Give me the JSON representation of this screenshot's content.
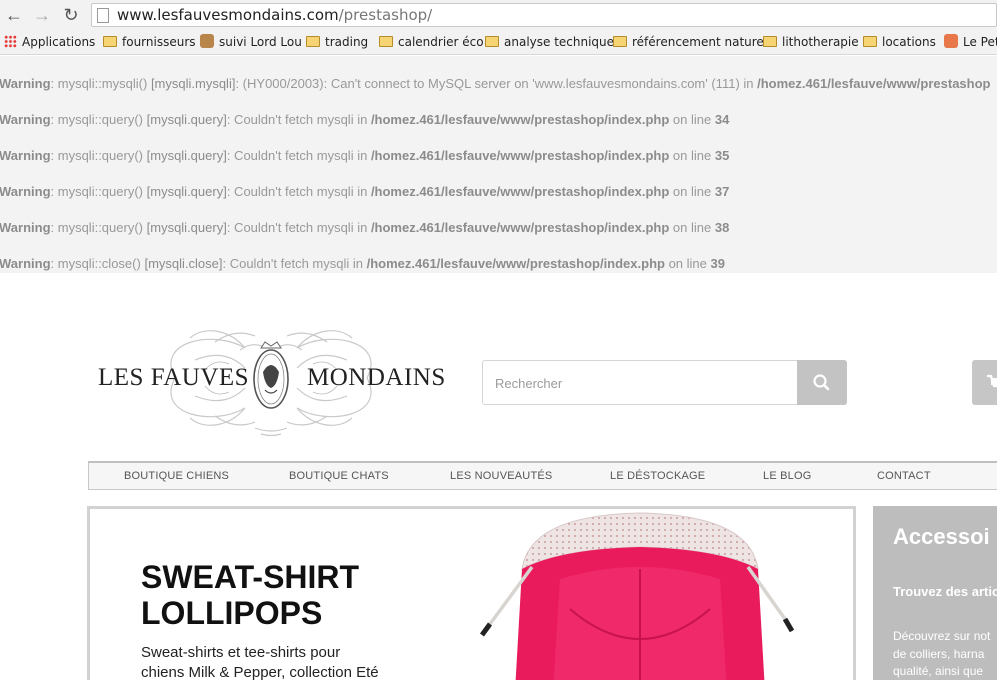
{
  "browser": {
    "url_host": "www.lesfauvesmondains.com",
    "url_path": "/prestashop/",
    "bookmarks": [
      {
        "label": "Applications",
        "icon": "apps-grid-icon"
      },
      {
        "label": "fournisseurs",
        "icon": "folder-icon"
      },
      {
        "label": "suivi Lord Lou",
        "icon": "site-icon"
      },
      {
        "label": "trading",
        "icon": "folder-icon"
      },
      {
        "label": "calendrier éco",
        "icon": "folder-icon"
      },
      {
        "label": "analyse technique",
        "icon": "folder-icon"
      },
      {
        "label": "référencement naturel",
        "icon": "folder-icon"
      },
      {
        "label": "lithotherapie",
        "icon": "folder-icon"
      },
      {
        "label": "locations",
        "icon": "folder-icon"
      },
      {
        "label": "Le Pet",
        "icon": "site-icon"
      }
    ]
  },
  "warnings": [
    {
      "label": "Warning",
      "func": "mysqli::mysqli()",
      "ref": "[mysqli.mysqli]",
      "msg": ": (HY000/2003): Can't connect to MySQL server on 'www.lesfauvesmondains.com' (111) in ",
      "path": "/homez.461/lesfauve/www/prestashop",
      "online": "",
      "line": ""
    },
    {
      "label": "Warning",
      "func": "mysqli::query()",
      "ref": "[mysqli.query]",
      "msg": ": Couldn't fetch mysqli in ",
      "path": "/homez.461/lesfauve/www/prestashop/index.php",
      "online": " on line ",
      "line": "34"
    },
    {
      "label": "Warning",
      "func": "mysqli::query()",
      "ref": "[mysqli.query]",
      "msg": ": Couldn't fetch mysqli in ",
      "path": "/homez.461/lesfauve/www/prestashop/index.php",
      "online": " on line ",
      "line": "35"
    },
    {
      "label": "Warning",
      "func": "mysqli::query()",
      "ref": "[mysqli.query]",
      "msg": ": Couldn't fetch mysqli in ",
      "path": "/homez.461/lesfauve/www/prestashop/index.php",
      "online": " on line ",
      "line": "37"
    },
    {
      "label": "Warning",
      "func": "mysqli::query()",
      "ref": "[mysqli.query]",
      "msg": ": Couldn't fetch mysqli in ",
      "path": "/homez.461/lesfauve/www/prestashop/index.php",
      "online": " on line ",
      "line": "38"
    },
    {
      "label": "Warning",
      "func": "mysqli::close()",
      "ref": "[mysqli.close]",
      "msg": ": Couldn't fetch mysqli in ",
      "path": "/homez.461/lesfauve/www/prestashop/index.php",
      "online": " on line ",
      "line": "39"
    }
  ],
  "shop": {
    "logo_left": "LES FAUVES",
    "logo_right": "MONDAINS",
    "search_placeholder": "Rechercher",
    "menu": [
      "BOUTIQUE CHIENS",
      "BOUTIQUE CHATS",
      "LES NOUVEAUTÉS",
      "LE DÉSTOCKAGE",
      "LE BLOG",
      "CONTACT"
    ],
    "slide": {
      "title_line1": "SWEAT-SHIRT",
      "title_line2": "LOLLIPOPS",
      "desc_line1": "Sweat-shirts et tee-shirts pour",
      "desc_line2": "chiens Milk & Pepper, collection Eté"
    },
    "banner": {
      "title": "Accessoi",
      "subtitle": "Trouvez des artic",
      "text_line1": "Découvrez sur not",
      "text_line2": "de colliers, harna",
      "text_line3": "qualité, ainsi que"
    }
  },
  "colors": {
    "hoodie_pink": "#e8185a",
    "hood_lining": "#eadcdc"
  }
}
